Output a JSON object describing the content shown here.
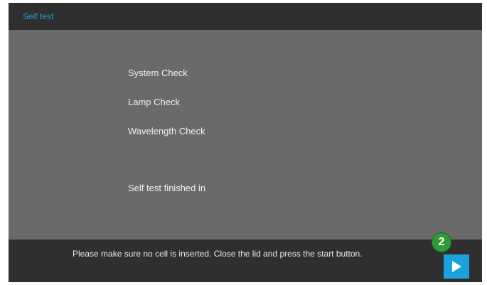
{
  "header": {
    "title": "Self test"
  },
  "checks": [
    {
      "label": "System Check"
    },
    {
      "label": "Lamp Check"
    },
    {
      "label": "Wavelength Check"
    }
  ],
  "status": {
    "finished_text": "Self test finished in"
  },
  "footer": {
    "message": "Please make sure no cell is inserted. Close the lid and press the start button."
  },
  "start_button": {
    "icon": "play-icon",
    "color": "#1ba1dc"
  },
  "callout": {
    "number": "2",
    "color": "#2e9b3a"
  },
  "colors": {
    "header_bg": "#2f2f2f",
    "body_bg": "#6a6a6a",
    "title_accent": "#1e9fd8"
  }
}
